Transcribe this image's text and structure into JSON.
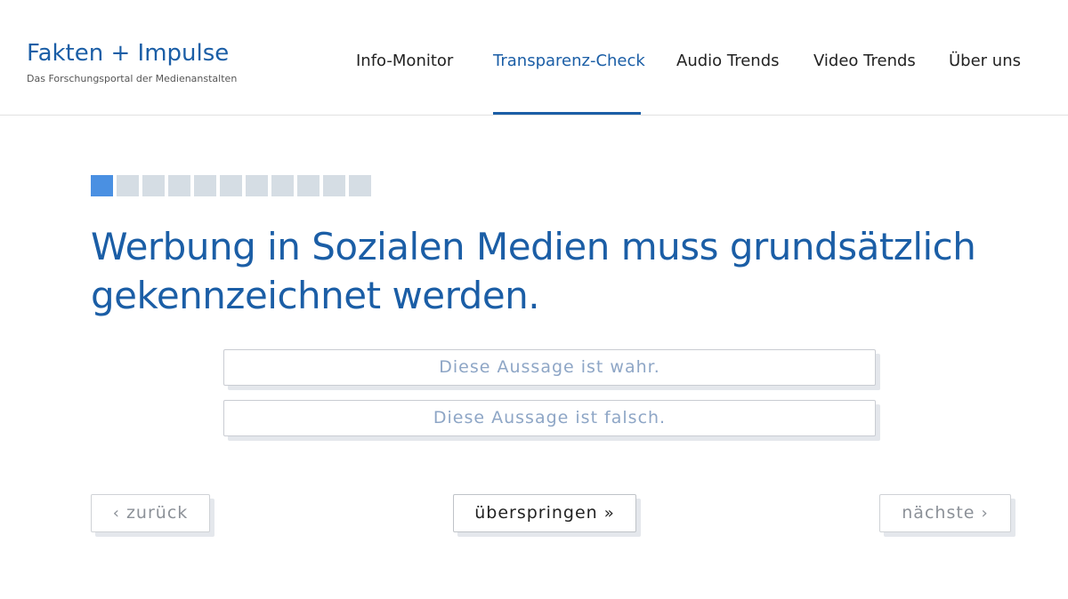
{
  "header": {
    "logo_title": "Fakten + Impulse",
    "logo_subtitle": "Das Forschungsportal der Medienanstalten",
    "nav": [
      {
        "label": "Info-Monitor",
        "active": false
      },
      {
        "label": "Transparenz-Check",
        "active": true
      },
      {
        "label": "Audio Trends",
        "active": false
      },
      {
        "label": "Video Trends",
        "active": false
      },
      {
        "label": "Über uns",
        "active": false
      }
    ]
  },
  "quiz": {
    "progress": {
      "current": 1,
      "total": 11
    },
    "question": "Werbung in Sozialen Medien muss grundsätzlich gekennzeichnet werden.",
    "answers": {
      "true_label": "Diese Aussage ist wahr.",
      "false_label": "Diese Aussage ist falsch."
    }
  },
  "controls": {
    "back_label": "zurück",
    "skip_label": "überspringen",
    "next_label": "nächste",
    "back_icon": "chevron-left-icon",
    "skip_icon": "double-chevron-right-icon",
    "next_icon": "chevron-right-icon"
  },
  "colors": {
    "brand_blue": "#1b5ea6",
    "progress_done": "#4a90e2",
    "progress_todo": "#d5dde4"
  }
}
